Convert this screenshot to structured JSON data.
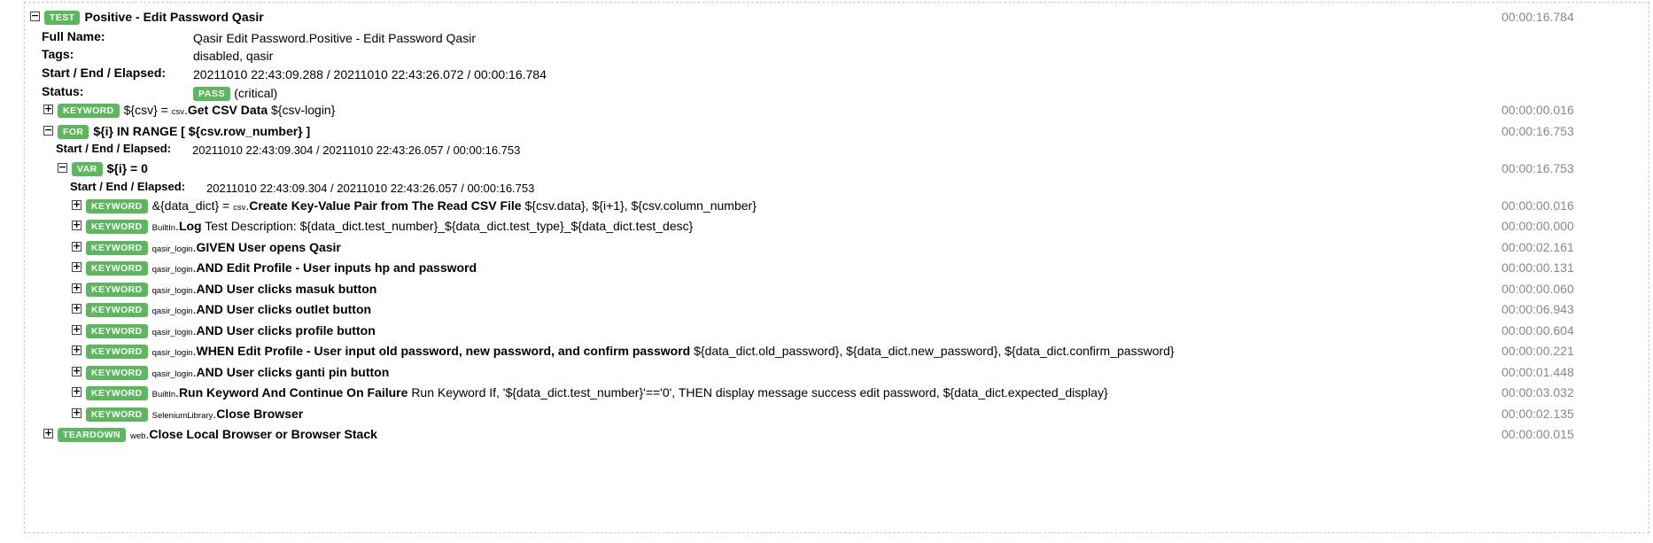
{
  "test": {
    "badge": "TEST",
    "name": "Positive - Edit Password Qasir",
    "elapsed": "00:00:16.784",
    "full_name_label": "Full Name:",
    "full_name": "Qasir Edit Password.Positive - Edit Password Qasir",
    "tags_label": "Tags:",
    "tags": "disabled, qasir",
    "times_label": "Start / End / Elapsed:",
    "times": "20211010 22:43:09.288 / 20211010 22:43:26.072 / 00:00:16.784",
    "status_label": "Status:",
    "status": "PASS",
    "status_note": "(critical)"
  },
  "kw_csv": {
    "badge": "KEYWORD",
    "assign": "${csv} = ",
    "lib": "csv",
    "name": "Get CSV Data",
    "args": "${csv-login}",
    "elapsed": "00:00:00.016"
  },
  "for_loop": {
    "badge": "FOR",
    "name": "${i} IN RANGE [ ${csv.row_number} ]",
    "elapsed": "00:00:16.753",
    "times_label": "Start / End / Elapsed:",
    "times": "20211010 22:43:09.304 / 20211010 22:43:26.057 / 00:00:16.753"
  },
  "var": {
    "badge": "VAR",
    "name": "${i} = 0",
    "elapsed": "00:00:16.753",
    "times_label": "Start / End / Elapsed:",
    "times": "20211010 22:43:09.304 / 20211010 22:43:26.057 / 00:00:16.753"
  },
  "keywords": [
    {
      "badge": "KEYWORD",
      "assign": "&{data_dict} = ",
      "lib": "csv",
      "name": "Create Key-Value Pair from The Read CSV File",
      "args": "${csv.data}, ${i+1}, ${csv.column_number}",
      "elapsed": "00:00:00.016"
    },
    {
      "badge": "KEYWORD",
      "assign": "",
      "lib": "BuiltIn",
      "name": "Log",
      "args": "Test Description: ${data_dict.test_number}_${data_dict.test_type}_${data_dict.test_desc}",
      "elapsed": "00:00:00.000"
    },
    {
      "badge": "KEYWORD",
      "assign": "",
      "lib": "qasir_login",
      "name": "GIVEN User opens Qasir",
      "args": "",
      "elapsed": "00:00:02.161"
    },
    {
      "badge": "KEYWORD",
      "assign": "",
      "lib": "qasir_login",
      "name": "AND Edit Profile - User inputs hp and password",
      "args": "",
      "elapsed": "00:00:00.131"
    },
    {
      "badge": "KEYWORD",
      "assign": "",
      "lib": "qasir_login",
      "name": "AND User clicks masuk button",
      "args": "",
      "elapsed": "00:00:00.060"
    },
    {
      "badge": "KEYWORD",
      "assign": "",
      "lib": "qasir_login",
      "name": "AND User clicks outlet button",
      "args": "",
      "elapsed": "00:00:06.943"
    },
    {
      "badge": "KEYWORD",
      "assign": "",
      "lib": "qasir_login",
      "name": "AND User clicks profile button",
      "args": "",
      "elapsed": "00:00:00.604"
    },
    {
      "badge": "KEYWORD",
      "assign": "",
      "lib": "qasir_login",
      "name": "WHEN Edit Profile - User input old password, new password, and confirm password",
      "args": "${data_dict.old_password}, ${data_dict.new_password}, ${data_dict.confirm_password}",
      "elapsed": "00:00:00.221"
    },
    {
      "badge": "KEYWORD",
      "assign": "",
      "lib": "qasir_login",
      "name": "AND User clicks ganti pin button",
      "args": "",
      "elapsed": "00:00:01.448"
    },
    {
      "badge": "KEYWORD",
      "assign": "",
      "lib": "BuiltIn",
      "name": "Run Keyword And Continue On Failure",
      "args": "Run Keyword If, '${data_dict.test_number}'=='0', THEN display message success edit password, ${data_dict.expected_display}",
      "elapsed": "00:00:03.032"
    },
    {
      "badge": "KEYWORD",
      "assign": "",
      "lib": "SeleniumLibrary",
      "name": "Close Browser",
      "args": "",
      "elapsed": "00:00:02.135"
    }
  ],
  "teardown": {
    "badge": "TEARDOWN",
    "lib": "web",
    "name": "Close Local Browser or Browser Stack",
    "elapsed": "00:00:00.015"
  },
  "icons": {
    "expand": "+",
    "collapse": "−"
  },
  "colors": {
    "badge_green": "#5cb85c",
    "elapsed_gray": "#888888",
    "frame_border": "#cccccc"
  }
}
